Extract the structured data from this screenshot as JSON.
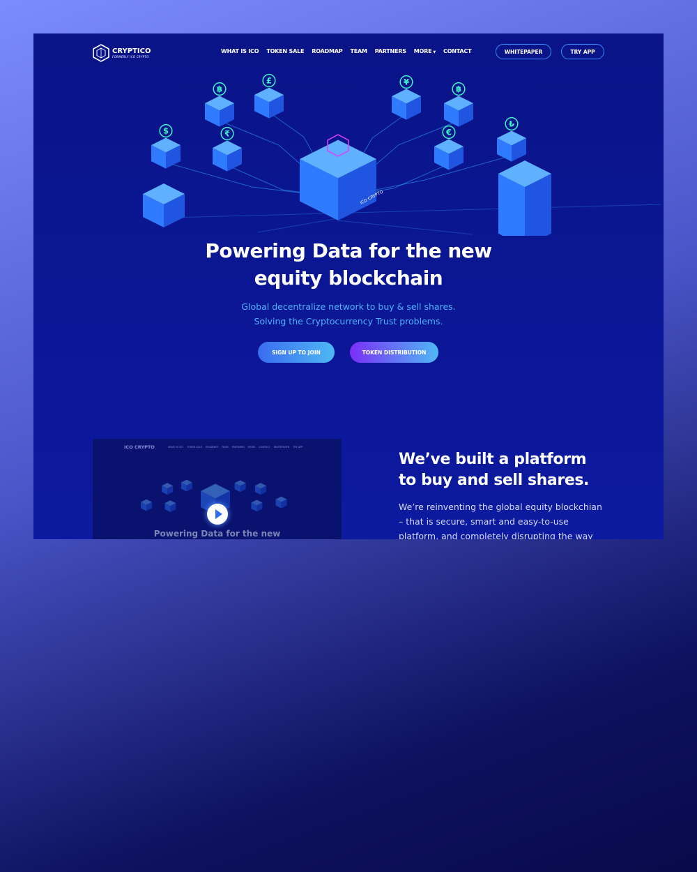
{
  "brand": {
    "name": "CRYPTICO",
    "tagline": "FORMERLY ICO CRYPTO"
  },
  "nav": {
    "items": [
      "WHAT IS ICO",
      "TOKEN SALE",
      "ROADMAP",
      "TEAM",
      "PARTNERS",
      "MORE",
      "CONTACT"
    ],
    "whitepaper": "WHITEPAPER",
    "try_app": "TRY APP"
  },
  "hero": {
    "title_line1": "Powering Data for the new",
    "title_line2": "equity blockchain",
    "subtitle_line1": "Global decentralize network to buy & sell shares.",
    "subtitle_line2": "Solving the Cryptocurrency Trust problems.",
    "cta_primary": "SIGN UP TO JOIN",
    "cta_secondary": "TOKEN DISTRIBUTION",
    "illustration_label": "ICO CRYPTO",
    "currency_symbols": [
      "$",
      "฿",
      "£",
      "₹",
      "฿",
      "¥",
      "₿",
      "€",
      "₺"
    ]
  },
  "video": {
    "thumbnail_brand": "ICO CRYPTO",
    "thumbnail_title": "Powering Data for the new",
    "thumbnail_nav": [
      "WHAT IS ICO",
      "TOKEN SALE",
      "ROADMAP",
      "TEAM",
      "PARTNERS",
      "MORE",
      "CONTACT",
      "WHITEPAPER",
      "TRY APP"
    ]
  },
  "about": {
    "title_line1": "We’ve built a platform",
    "title_line2": "to buy and sell shares.",
    "body": "We’re reinventing the global equity blockchian – that is secure, smart and easy-to-use platform, and completely disrupting the way"
  },
  "colors": {
    "accent": "#3a8cff",
    "subtitle": "#4fb3ff",
    "cube": "#2f7bff",
    "page_bg": "#0b1796",
    "cta_grad_start": "#3a6cf0",
    "cta2_grad_start": "#7b2ff7"
  }
}
